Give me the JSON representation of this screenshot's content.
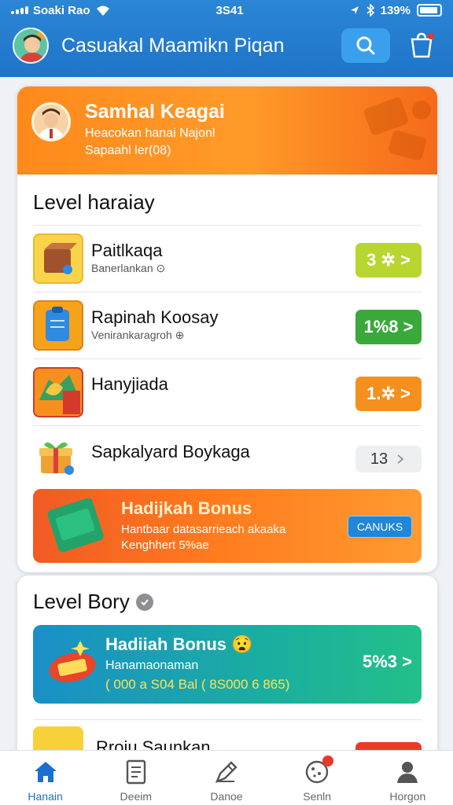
{
  "status_bar": {
    "carrier": "Soaki Rao",
    "time": "3S41",
    "battery": "139%"
  },
  "header": {
    "title": "Casuakal Maamikn Piqan",
    "search_icon": "search-icon",
    "cart_icon": "cart-icon"
  },
  "profile": {
    "name": "Samhal Keagai",
    "line1": "Heacokan hanai Najonl",
    "line2": "Sapaahl ler(08)"
  },
  "level_section": {
    "title": "Level haraiay",
    "items": [
      {
        "title": "Paitlkaqa",
        "subtitle": "Banerlankan ⊙",
        "value": "3 ✲ >",
        "color": "#b8d630"
      },
      {
        "title": "Rapinah Koosay",
        "subtitle": "Venirankaragroh ⊕",
        "value": "1%8 >",
        "color": "#3aa83a"
      },
      {
        "title": "Hanyjiada",
        "subtitle": "",
        "value": "1.✲ >",
        "color": "#f5901e"
      },
      {
        "title": "Sapkalyard Boykaga",
        "subtitle": "",
        "value": "13",
        "color": "#eeeff1"
      }
    ]
  },
  "promo": {
    "title": "Hadijkah Bonus",
    "line1": "Hantbaar datasarrieach akaaka",
    "line2": "Kenghhert 5%ae",
    "button": "CANUKS"
  },
  "bonus_section": {
    "title": "Level Bory",
    "card_title": "Hadiiah Bonus",
    "card_emoji": "😧",
    "card_line1": "Hanamaonaman",
    "card_line2": "( 000 a S04 Bal ( 8S000 6 865)",
    "card_value": "5%3 >",
    "partial_item": "Rroju Saunkan"
  },
  "bottom_nav": [
    {
      "label": "Hanain",
      "icon": "home-icon",
      "active": true
    },
    {
      "label": "Deeim",
      "icon": "document-icon",
      "active": false
    },
    {
      "label": "Danoe",
      "icon": "pen-icon",
      "active": false
    },
    {
      "label": "Senln",
      "icon": "cookie-icon",
      "active": false
    },
    {
      "label": "Horgon",
      "icon": "profile-icon",
      "active": false
    }
  ]
}
